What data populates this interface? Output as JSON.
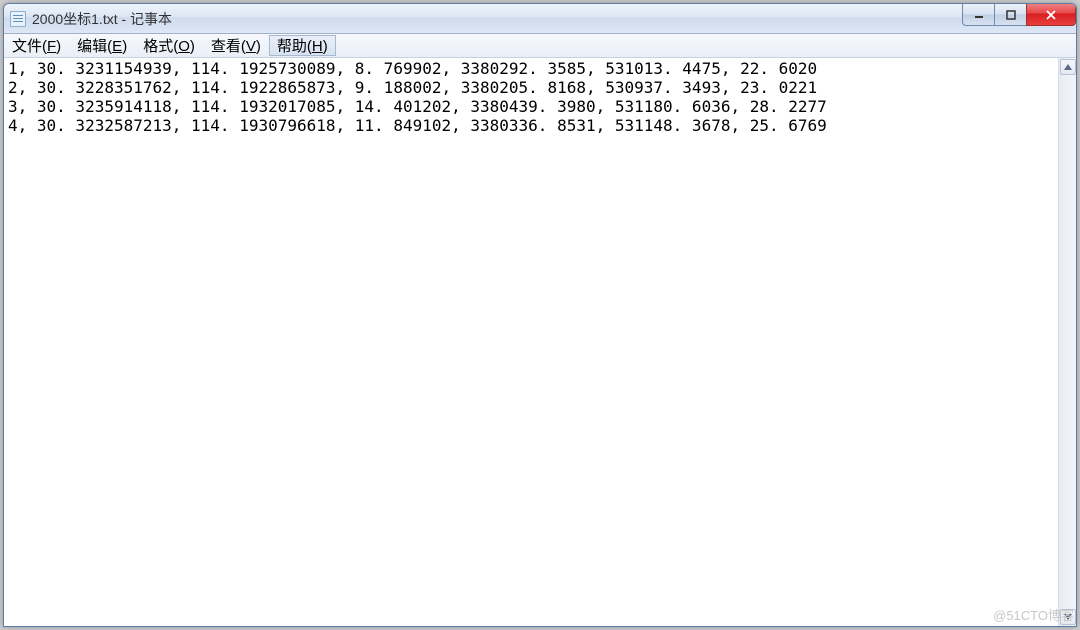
{
  "titlebar": {
    "title": "2000坐标1.txt - 记事本"
  },
  "menu": {
    "file": "文件(F)",
    "edit": "编辑(E)",
    "format": "格式(O)",
    "view": "查看(V)",
    "help": "帮助(H)"
  },
  "content": {
    "lines": [
      "1, 30. 3231154939, 114. 1925730089, 8. 769902, 3380292. 3585, 531013. 4475, 22. 6020",
      "2, 30. 3228351762, 114. 1922865873, 9. 188002, 3380205. 8168, 530937. 3493, 23. 0221",
      "3, 30. 3235914118, 114. 1932017085, 14. 401202, 3380439. 3980, 531180. 6036, 28. 2277",
      "4, 30. 3232587213, 114. 1930796618, 11. 849102, 3380336. 8531, 531148. 3678, 25. 6769"
    ]
  },
  "watermark": "@51CTO博客"
}
